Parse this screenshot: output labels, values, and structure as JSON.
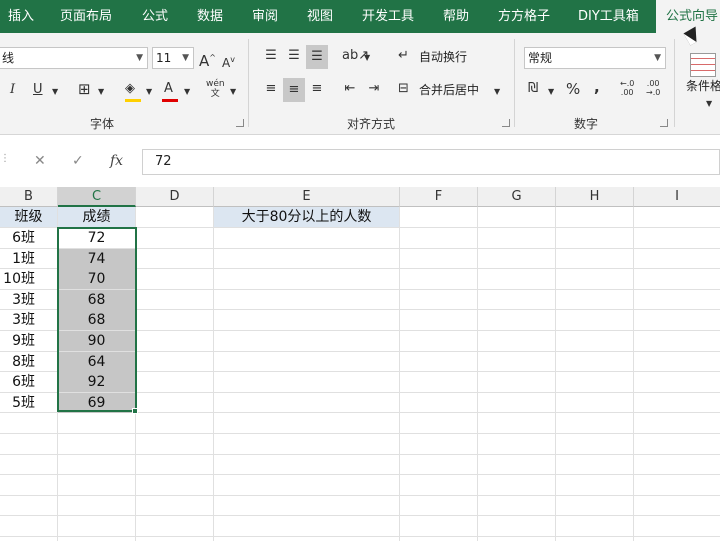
{
  "tabs": [
    "插入",
    "页面布局",
    "公式",
    "数据",
    "审阅",
    "视图",
    "开发工具",
    "帮助",
    "方方格子",
    "DIY工具箱",
    "公式向导"
  ],
  "active_tab": "公式向导",
  "ribbon": {
    "font_name": "线",
    "font_size": "11",
    "grow_font": "A",
    "shrink_font": "A",
    "italic": "I",
    "underline": "U",
    "font_color_glyph": "A",
    "phonetic": "wén",
    "font_group": "字体",
    "wrap_text": "自动换行",
    "merge_center": "合并后居中",
    "align_group": "对齐方式",
    "number_format": "常规",
    "percent": "%",
    "comma": ",",
    "number_group": "数字",
    "conditional_format": "条件格"
  },
  "formula_bar": {
    "fx_label": "fx",
    "value": "72"
  },
  "columns": [
    "B",
    "C",
    "D",
    "E",
    "F",
    "G",
    "H",
    "I"
  ],
  "selected_column": "C",
  "headers": {
    "B": "班级",
    "C": "成绩",
    "E": "大于80分以上的人数"
  },
  "rows": [
    {
      "class": "6班",
      "score": "72"
    },
    {
      "class": "1班",
      "score": "74"
    },
    {
      "class": "10班",
      "score": "70"
    },
    {
      "class": "3班",
      "score": "68"
    },
    {
      "class": "3班",
      "score": "68"
    },
    {
      "class": "9班",
      "score": "90"
    },
    {
      "class": "8班",
      "score": "64"
    },
    {
      "class": "6班",
      "score": "92"
    },
    {
      "class": "5班",
      "score": "69"
    }
  ],
  "colors": {
    "excel_green": "#217346",
    "header_fill": "#dce6f1",
    "selected_fill": "#c6c6c6"
  }
}
